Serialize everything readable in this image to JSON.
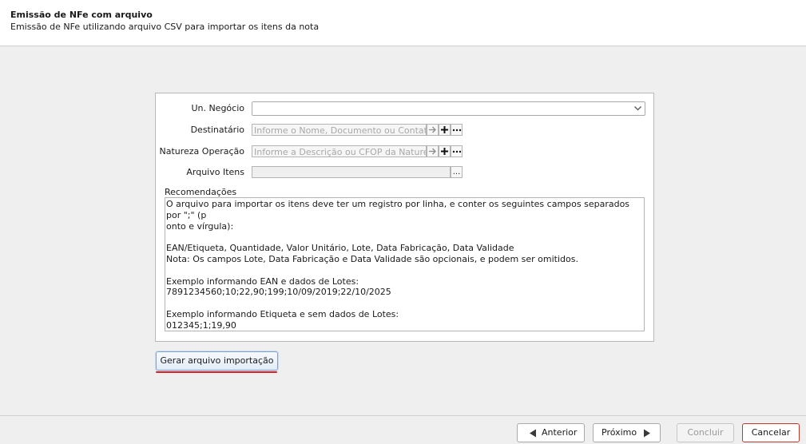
{
  "header": {
    "title": "Emissão de NFe com arquivo",
    "subtitle": "Emissão de NFe utilizando arquivo CSV para importar os itens da nota"
  },
  "form": {
    "un_negocio_label": "Un. Negócio",
    "un_negocio_value": "",
    "destinatario_label": "Destinatário",
    "destinatario_placeholder": "Informe o Nome, Documento ou Contato",
    "natureza_label": "Natureza Operação",
    "natureza_placeholder": "Informe a Descrição ou CFOP da Natureza",
    "arquivo_label": "Arquivo Itens",
    "arquivo_value": "",
    "browse_label": "...",
    "recomendacoes_label": "Recomendações",
    "recomendacoes_text": "O arquivo para importar os itens deve ter um registro por linha, e conter os seguintes campos separados por \";\" (p\nonto e vírgula):\n\nEAN/Etiqueta, Quantidade, Valor Unitário, Lote, Data Fabricação, Data Validade\nNota: Os campos Lote, Data Fabricação e Data Validade são opcionais, e podem ser omitidos.\n\nExemplo informando EAN e dados de Lotes:\n7891234560;10;22,90;199;10/09/2019;22/10/2025\n\nExemplo informando Etiqueta e sem dados de Lotes:\n012345;1;19,90"
  },
  "generate_button": "Gerar arquivo importação",
  "footer": {
    "anterior": "Anterior",
    "proximo": "Próximo",
    "concluir": "Concluir",
    "cancelar": "Cancelar"
  },
  "colors": {
    "highlight_underline": "#e02020",
    "cancel_border": "#c0392b"
  }
}
